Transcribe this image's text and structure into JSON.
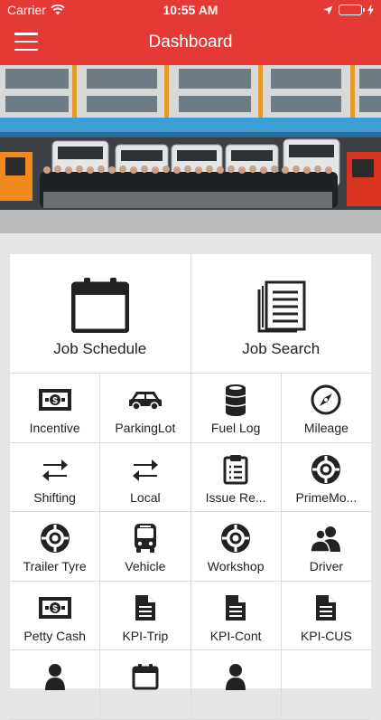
{
  "status_bar": {
    "carrier": "Carrier",
    "time": "10:55 AM",
    "battery_color": "#4cd964"
  },
  "nav": {
    "title": "Dashboard",
    "menu_icon": "hamburger-icon",
    "bar_color": "#e53935"
  },
  "hero": {
    "image": "team-photo-with-trucks"
  },
  "big_tiles": [
    {
      "label": "Job Schedule",
      "icon": "calendar-icon"
    },
    {
      "label": "Job Search",
      "icon": "document-list-icon"
    }
  ],
  "tiles": [
    {
      "label": "Incentive",
      "icon": "cash-icon"
    },
    {
      "label": "ParkingLot",
      "icon": "car-icon"
    },
    {
      "label": "Fuel Log",
      "icon": "fuel-barrel-icon"
    },
    {
      "label": "Mileage",
      "icon": "compass-icon"
    },
    {
      "label": "Shifting",
      "icon": "swap-arrows-icon"
    },
    {
      "label": "Local",
      "icon": "swap-arrows-icon"
    },
    {
      "label": "Issue Re...",
      "icon": "clipboard-icon"
    },
    {
      "label": "PrimeMo...",
      "icon": "tyre-icon"
    },
    {
      "label": "Trailer Tyre",
      "icon": "tyre-icon"
    },
    {
      "label": "Vehicle",
      "icon": "bus-icon"
    },
    {
      "label": "Workshop",
      "icon": "tyre-icon"
    },
    {
      "label": "Driver",
      "icon": "users-icon"
    },
    {
      "label": "Petty Cash",
      "icon": "cash-icon"
    },
    {
      "label": "KPI-Trip",
      "icon": "document-icon"
    },
    {
      "label": "KPI-Cont",
      "icon": "document-icon"
    },
    {
      "label": "KPI-CUS",
      "icon": "document-icon"
    },
    {
      "label": "",
      "icon": "user-icon"
    },
    {
      "label": "",
      "icon": "calendar-icon"
    },
    {
      "label": "",
      "icon": "user-icon"
    },
    {
      "label": "",
      "icon": ""
    }
  ]
}
